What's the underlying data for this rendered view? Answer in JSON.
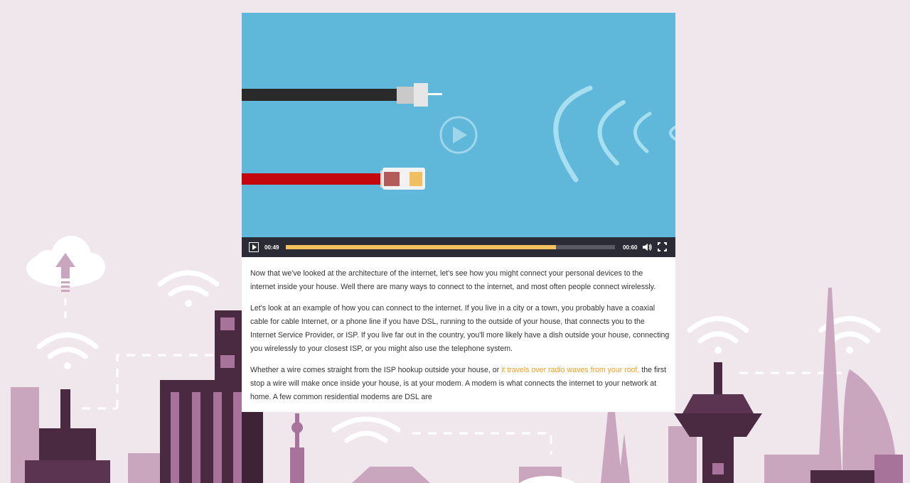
{
  "video": {
    "current_time": "00:49",
    "duration": "00:60",
    "progress_fraction": 0.82,
    "colors": {
      "background": "#5fb8da",
      "cable_black": "#2a2a2a",
      "cable_red": "#c3070c",
      "progress_fill": "#f5c15c"
    }
  },
  "article": {
    "p1": "Now that we've looked at the architecture of the internet, let's see how you might connect your personal devices to the internet inside your house. Well there are many ways to connect to the internet, and most often people connect wirelessly.",
    "p2": "Let's look at an example of how you can connect to the internet. If you live in a city or a town, you probably have a coaxial cable for cable Internet, or a phone line if you have DSL, running to the outside of your house, that connects you to the Internet Service Provider, or ISP. If you live far out in the country, you'll more likely have a dish outside your house, connecting you wirelessly to your closest ISP, or you might also use the telephone system.",
    "p3_before": "Whether a wire comes straight from the ISP hookup outside your house, or ",
    "p3_highlight": "it travels over radio waves from your roof,",
    "p3_after": " the first stop a wire will make once inside your house, is at your modem. A modem is what connects the internet to your network at home. A few common residential modems are DSL are"
  },
  "theme": {
    "page_background": "#efe7ec",
    "highlight": "#f49d22",
    "city_dark": "#4a2a40",
    "city_mid": "#a8739a",
    "city_light": "#c9a6bd"
  }
}
